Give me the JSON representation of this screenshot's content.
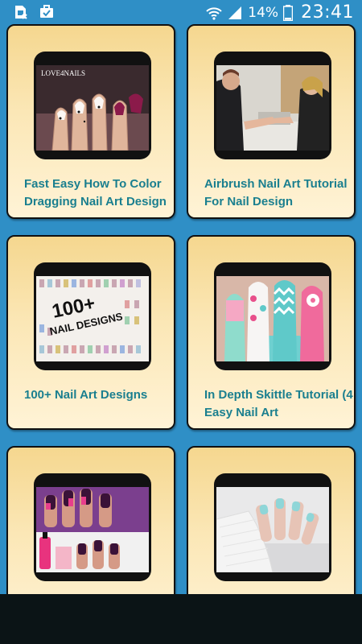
{
  "status_bar": {
    "battery_percent": "14%",
    "time": "23:41",
    "icons": [
      "sim-card-icon",
      "briefcase-check-icon",
      "wifi-icon",
      "signal-icon",
      "battery-icon"
    ]
  },
  "cards": [
    {
      "title": "Fast Easy How To Color Dragging Nail Art Design",
      "thumb_text": "LOVE4NAILS"
    },
    {
      "title": "Airbrush Nail Art Tutorial For Nail Design",
      "thumb_text": ""
    },
    {
      "title": "100+ Nail Art Designs",
      "thumb_text_line1": "100+",
      "thumb_text_line2": "NAIL DESIGNS"
    },
    {
      "title": "In Depth Skittle Tutorial (4 Easy Nail Art",
      "thumb_text": ""
    },
    {
      "title": "",
      "thumb_text": ""
    },
    {
      "title": "",
      "thumb_text": ""
    }
  ],
  "colors": {
    "status_bar": "#2f8fc6",
    "card_top": "#f5d78f",
    "card_bottom": "#fff3d6",
    "title_text": "#1a7f8f",
    "bottom_bar": "#0b1416"
  }
}
